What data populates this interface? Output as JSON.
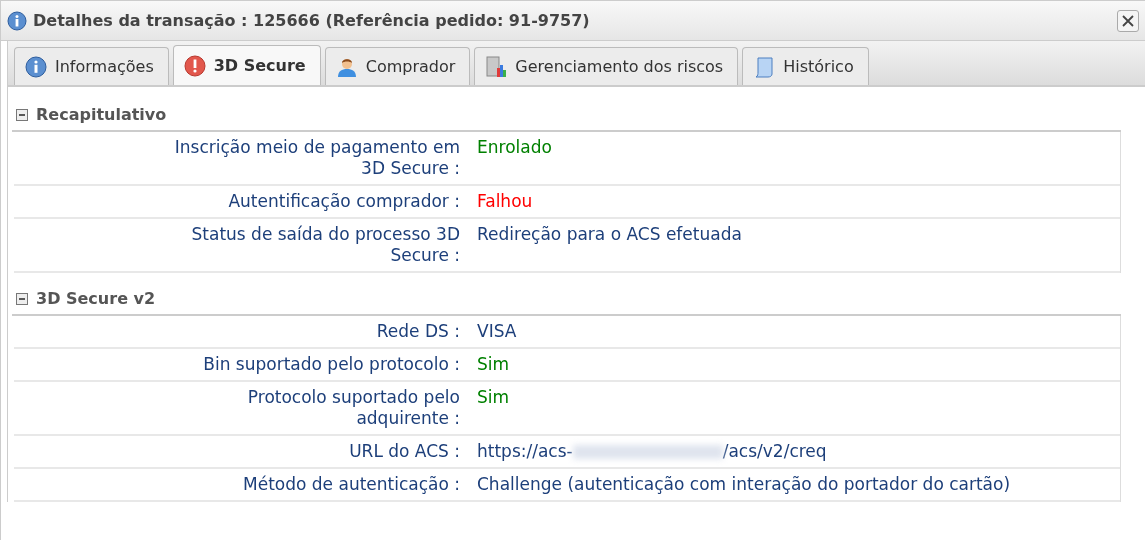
{
  "window": {
    "title": "Detalhes da transação : 125666 (Referência pedido: 91-9757)"
  },
  "tabs": [
    {
      "label": "Informações",
      "selected": false
    },
    {
      "label": "3D Secure",
      "selected": true
    },
    {
      "label": "Comprador",
      "selected": false
    },
    {
      "label": "Gerenciamento dos riscos",
      "selected": false
    },
    {
      "label": "Histórico",
      "selected": false
    }
  ],
  "sections": [
    {
      "title": "Recapitulativo",
      "expanded": true,
      "rows": [
        {
          "label": "Inscrição meio de pagamento em 3D Secure :",
          "kind": "text",
          "value": "Enrolado",
          "color": "#008000"
        },
        {
          "label": "Autentificação comprador :",
          "kind": "text",
          "value": "Falhou",
          "color": "#ff0000"
        },
        {
          "label": "Status de saída do processo 3D Secure :",
          "kind": "text",
          "value": "Redireção para o ACS efetuada",
          "color": "#1d3f7a"
        }
      ]
    },
    {
      "title": "3D Secure v2",
      "expanded": true,
      "rows": [
        {
          "label": "Rede DS :",
          "kind": "text",
          "value": "VISA",
          "color": "#1d3f7a"
        },
        {
          "label": "Bin suportado pelo protocolo :",
          "kind": "text",
          "value": "Sim",
          "color": "#008000"
        },
        {
          "label": "Protocolo suportado pelo adquirente :",
          "kind": "text",
          "value": "Sim",
          "color": "#008000"
        },
        {
          "label": "URL do ACS :",
          "kind": "redacted",
          "value": "https://acs-",
          "value_end": "/acs/v2/creq",
          "color": "#1d3f7a"
        },
        {
          "label": "Método de autenticação :",
          "kind": "text",
          "value": "Challenge (autenticação com interação do portador do cartão)",
          "color": "#1d3f7a"
        }
      ]
    }
  ]
}
